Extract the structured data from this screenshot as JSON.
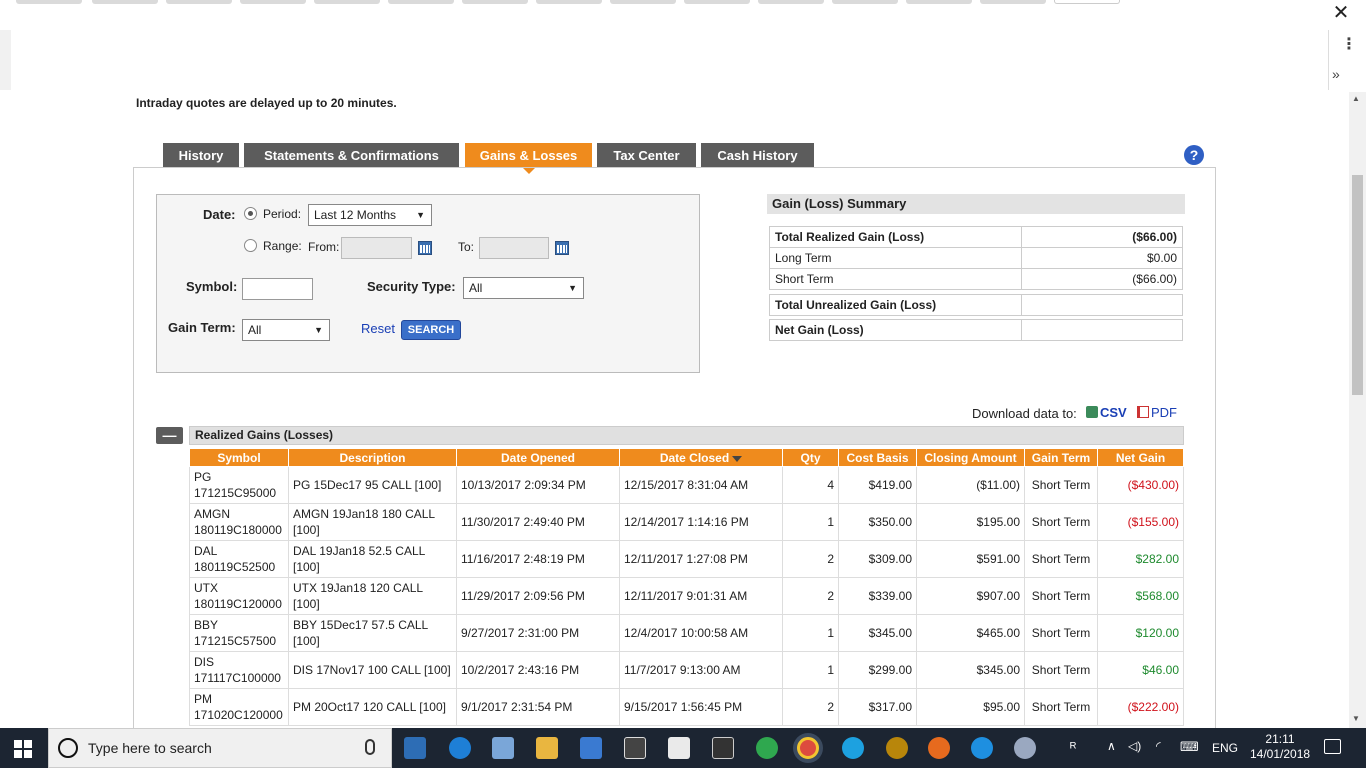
{
  "browser": {
    "close_glyph": "✕",
    "menu_glyph": "⋮",
    "more_glyph": "»"
  },
  "notice": "Intraday quotes are delayed up to 20 minutes.",
  "tabs": [
    {
      "label": "History",
      "active": false
    },
    {
      "label": "Statements & Confirmations",
      "active": false
    },
    {
      "label": "Gains & Losses",
      "active": true
    },
    {
      "label": "Tax Center",
      "active": false
    },
    {
      "label": "Cash History",
      "active": false
    }
  ],
  "help_glyph": "?",
  "form": {
    "date_label": "Date:",
    "period_label": "Period:",
    "period_value": "Last 12 Months",
    "range_label": "Range:",
    "from_label": "From:",
    "to_label": "To:",
    "symbol_label": "Symbol:",
    "security_type_label": "Security Type:",
    "security_type_value": "All",
    "gain_term_label": "Gain Term:",
    "gain_term_value": "All",
    "reset_label": "Reset",
    "search_label": "SEARCH",
    "dropdown_glyph": "▼"
  },
  "summary": {
    "title": "Gain (Loss) Summary",
    "rows": [
      {
        "label": "Total Realized Gain (Loss)",
        "value": "($66.00)"
      },
      {
        "label": "Long Term",
        "value": "$0.00"
      },
      {
        "label": "Short Term",
        "value": "($66.00)"
      }
    ],
    "unrealized_label": "Total Unrealized Gain (Loss)",
    "unrealized_value": "",
    "net_label": "Net Gain (Loss)",
    "net_value": ""
  },
  "download": {
    "label": "Download data to:",
    "csv": "CSV",
    "pdf": "PDF"
  },
  "realized": {
    "collapse_glyph": "—",
    "title": "Realized Gains (Losses)",
    "columns": [
      "Symbol",
      "Description",
      "Date Opened",
      "Date Closed",
      "Qty",
      "Cost Basis",
      "Closing Amount",
      "Gain Term",
      "Net Gain"
    ],
    "rows": [
      {
        "sym1": "PG",
        "sym2": "171215C95000",
        "desc": "PG 15Dec17 95 CALL [100]",
        "opened": "10/13/2017 2:09:34 PM",
        "closed": "12/15/2017 8:31:04 AM",
        "qty": "4",
        "cost": "$419.00",
        "closing": "($11.00)",
        "term": "Short Term",
        "net": "($430.00)",
        "sign": "neg"
      },
      {
        "sym1": "AMGN",
        "sym2": "180119C180000",
        "desc": "AMGN 19Jan18 180 CALL [100]",
        "opened": "11/30/2017 2:49:40 PM",
        "closed": "12/14/2017 1:14:16 PM",
        "qty": "1",
        "cost": "$350.00",
        "closing": "$195.00",
        "term": "Short Term",
        "net": "($155.00)",
        "sign": "neg"
      },
      {
        "sym1": "DAL",
        "sym2": "180119C52500",
        "desc": "DAL 19Jan18 52.5 CALL [100]",
        "opened": "11/16/2017 2:48:19 PM",
        "closed": "12/11/2017 1:27:08 PM",
        "qty": "2",
        "cost": "$309.00",
        "closing": "$591.00",
        "term": "Short Term",
        "net": "$282.00",
        "sign": "pos"
      },
      {
        "sym1": "UTX",
        "sym2": "180119C120000",
        "desc": "UTX 19Jan18 120 CALL [100]",
        "opened": "11/29/2017 2:09:56 PM",
        "closed": "12/11/2017 9:01:31 AM",
        "qty": "2",
        "cost": "$339.00",
        "closing": "$907.00",
        "term": "Short Term",
        "net": "$568.00",
        "sign": "pos"
      },
      {
        "sym1": "BBY",
        "sym2": "171215C57500",
        "desc": "BBY 15Dec17 57.5 CALL [100]",
        "opened": "9/27/2017 2:31:00 PM",
        "closed": "12/4/2017 10:00:58 AM",
        "qty": "1",
        "cost": "$345.00",
        "closing": "$465.00",
        "term": "Short Term",
        "net": "$120.00",
        "sign": "pos"
      },
      {
        "sym1": "DIS",
        "sym2": "171117C100000",
        "desc": "DIS 17Nov17 100 CALL [100]",
        "opened": "10/2/2017 2:43:16 PM",
        "closed": "11/7/2017 9:13:00 AM",
        "qty": "1",
        "cost": "$299.00",
        "closing": "$345.00",
        "term": "Short Term",
        "net": "$46.00",
        "sign": "pos"
      },
      {
        "sym1": "PM",
        "sym2": "171020C120000",
        "desc": "PM 20Oct17 120 CALL [100]",
        "opened": "9/1/2017 2:31:54 PM",
        "closed": "9/15/2017 1:56:45 PM",
        "qty": "2",
        "cost": "$317.00",
        "closing": "$95.00",
        "term": "Short Term",
        "net": "($222.00)",
        "sign": "neg"
      }
    ]
  },
  "taskbar": {
    "search_placeholder": "Type here to search",
    "lang": "ENG",
    "time": "21:11",
    "date": "14/01/2018"
  },
  "colors": {
    "tab_gray": "#5c5c5c",
    "tab_active": "#ef8b1d",
    "negative": "#d0121b",
    "positive": "#1e8a2e",
    "link": "#1a3fb5"
  }
}
